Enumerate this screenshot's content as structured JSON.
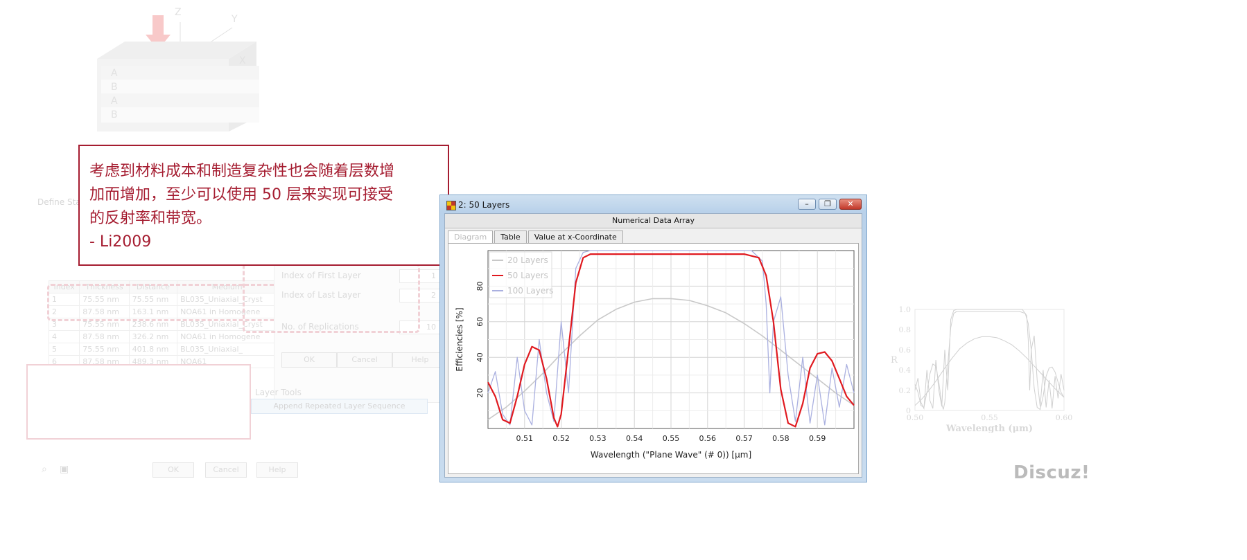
{
  "illustration": {
    "axes": {
      "z": "Z",
      "y": "Y",
      "x": "X"
    },
    "layers": [
      "A",
      "B",
      "A",
      "B"
    ]
  },
  "bg_dialog": {
    "title": "Define Stack",
    "table_headers": [
      "Index",
      "Thickness",
      "Distance",
      "Medium"
    ],
    "rows": [
      [
        "1",
        "75.55 nm",
        "75.55 nm",
        "BL035_Uniaxial_Cryst"
      ],
      [
        "2",
        "87.58 nm",
        "163.1 nm",
        "NOA61 in Homogene"
      ],
      [
        "3",
        "75.55 nm",
        "238.6 nm",
        "BL035_Uniaxial_Cryst"
      ],
      [
        "4",
        "87.58 nm",
        "326.2 nm",
        "NOA61 in Homogene"
      ],
      [
        "5",
        "75.55 nm",
        "401.8 nm",
        "BL035_Uniaxial_"
      ],
      [
        "6",
        "87.58 nm",
        "489.3 nm",
        "NOA61"
      ]
    ],
    "index_first_label": "Index of First Layer",
    "index_first_value": "1",
    "index_last_label": "Index of Last Layer",
    "index_last_value": "2",
    "replications_label": "No. of Replications",
    "replications_value": "10",
    "ok": "OK",
    "cancel": "Cancel",
    "help": "Help",
    "layer_tools": "Layer Tools",
    "append_button": "Append Repeated Layer Sequence"
  },
  "callout": {
    "line1": "考虑到材料成本和制造复杂性也会随着层数增",
    "line2": "加而增加，至少可以使用 50 层来实现可接受",
    "line3": "的反射率和带宽。",
    "line4": "- Li2009",
    "border_color": "#a51c30"
  },
  "window": {
    "title": "2: 50 Layers",
    "header": "Numerical Data Array",
    "tabs": [
      "Diagram",
      "Table",
      "Value at x-Coordinate"
    ],
    "active_tab": "Diagram",
    "buttons": {
      "minimize": "minimize-icon",
      "restore": "restore-icon",
      "close": "close-icon"
    }
  },
  "chart_data": {
    "type": "line",
    "title": "",
    "xlabel": "Wavelength (\"Plane Wave\" (# 0)) [µm]",
    "ylabel": "Efficiencies   [%]",
    "xlim": [
      0.5,
      0.6
    ],
    "ylim": [
      0,
      100
    ],
    "x_ticks": [
      "0.51",
      "0.52",
      "0.53",
      "0.54",
      "0.55",
      "0.56",
      "0.57",
      "0.58",
      "0.59"
    ],
    "y_ticks": [
      "20",
      "40",
      "60",
      "80"
    ],
    "grid": true,
    "legend_position": "top-left",
    "series": [
      {
        "name": "20 Layers",
        "color": "#c8c8c8",
        "x": [
          0.5,
          0.505,
          0.51,
          0.515,
          0.52,
          0.525,
          0.53,
          0.535,
          0.54,
          0.545,
          0.55,
          0.555,
          0.56,
          0.565,
          0.57,
          0.575,
          0.58,
          0.585,
          0.59,
          0.595,
          0.6
        ],
        "y": [
          5,
          12,
          21,
          31,
          42,
          52,
          61,
          67,
          71,
          73,
          73,
          72,
          69,
          65,
          59,
          52,
          44,
          36,
          28,
          20,
          13
        ]
      },
      {
        "name": "50 Layers",
        "color": "#e0191f",
        "x": [
          0.5,
          0.502,
          0.504,
          0.506,
          0.508,
          0.51,
          0.512,
          0.514,
          0.516,
          0.518,
          0.519,
          0.52,
          0.522,
          0.524,
          0.526,
          0.528,
          0.53,
          0.54,
          0.55,
          0.56,
          0.57,
          0.574,
          0.576,
          0.578,
          0.58,
          0.582,
          0.584,
          0.586,
          0.588,
          0.59,
          0.592,
          0.594,
          0.596,
          0.598,
          0.6
        ],
        "y": [
          26,
          18,
          5,
          3,
          18,
          36,
          46,
          44,
          28,
          6,
          1,
          8,
          45,
          82,
          96,
          98,
          98,
          98,
          98,
          98,
          98,
          96,
          86,
          60,
          22,
          3,
          1,
          14,
          34,
          42,
          43,
          38,
          28,
          18,
          13
        ]
      },
      {
        "name": "100 Layers",
        "color": "#aab0e0",
        "x": [
          0.5,
          0.502,
          0.504,
          0.506,
          0.508,
          0.51,
          0.512,
          0.514,
          0.516,
          0.518,
          0.52,
          0.522,
          0.524,
          0.526,
          0.528,
          0.54,
          0.56,
          0.572,
          0.575,
          0.576,
          0.577,
          0.578,
          0.58,
          0.582,
          0.584,
          0.586,
          0.588,
          0.59,
          0.592,
          0.594,
          0.596,
          0.598,
          0.6
        ],
        "y": [
          20,
          32,
          8,
          2,
          40,
          10,
          2,
          50,
          20,
          4,
          60,
          20,
          90,
          99,
          100,
          100,
          100,
          100,
          94,
          70,
          20,
          60,
          74,
          30,
          4,
          40,
          3,
          30,
          2,
          34,
          12,
          36,
          20
        ]
      }
    ]
  },
  "thumbnail_plot": {
    "ylabel": "R",
    "xlabel": "Wavelength (μm)",
    "x_ticks": [
      "0.50",
      "0.55",
      "0.60"
    ],
    "y_ticks": [
      "0",
      "0.2",
      "0.4",
      "0.6",
      "0.8",
      "1.0"
    ]
  },
  "watermark": "Discuz!"
}
